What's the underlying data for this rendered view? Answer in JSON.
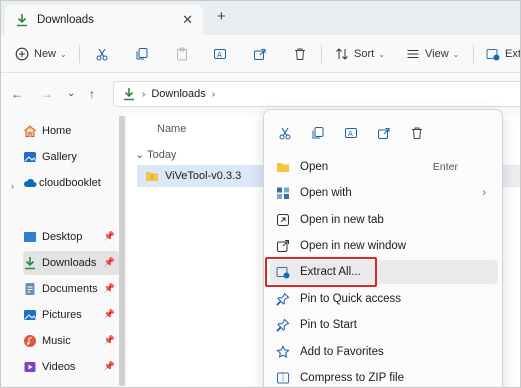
{
  "tab": {
    "title": "Downloads",
    "close_glyph": "✕",
    "new_tab_glyph": "+"
  },
  "commandbar": {
    "new_label": "New",
    "sort_label": "Sort",
    "view_label": "View",
    "extract_label": "Ext"
  },
  "address": {
    "crumbs": [
      "Downloads"
    ]
  },
  "sidebar": {
    "items": [
      {
        "label": "Home"
      },
      {
        "label": "Gallery"
      },
      {
        "label": "cloudbooklet"
      },
      {
        "label": "Desktop"
      },
      {
        "label": "Downloads"
      },
      {
        "label": "Documents"
      },
      {
        "label": "Pictures"
      },
      {
        "label": "Music"
      },
      {
        "label": "Videos"
      }
    ]
  },
  "filelist": {
    "column_name": "Name",
    "group_label": "Today",
    "files": [
      {
        "name": "ViVeTool-v0.3.3"
      }
    ]
  },
  "context_menu": {
    "items": [
      {
        "label": "Open",
        "shortcut": "Enter"
      },
      {
        "label": "Open with"
      },
      {
        "label": "Open in new tab"
      },
      {
        "label": "Open in new window"
      },
      {
        "label": "Extract All..."
      },
      {
        "label": "Pin to Quick access"
      },
      {
        "label": "Pin to Start"
      },
      {
        "label": "Add to Favorites"
      },
      {
        "label": "Compress to ZIP file"
      }
    ]
  },
  "colors": {
    "accent": "#0f6cbd",
    "download_green": "#2b8a3e",
    "folder_yellow": "#f4c542",
    "highlight_red": "#d9262c"
  }
}
